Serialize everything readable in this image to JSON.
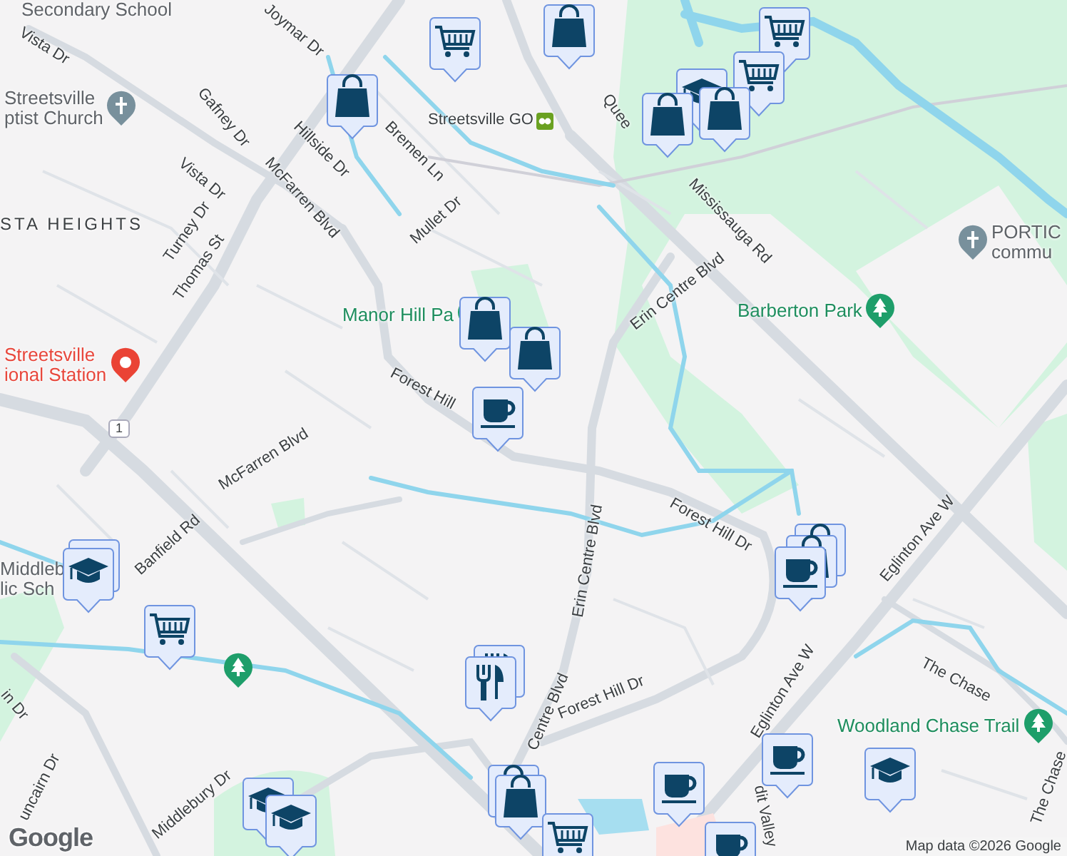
{
  "map": {
    "labels": [
      {
        "kind": "poi",
        "lines": [
          "Secondary School"
        ]
      },
      {
        "kind": "street",
        "lines": [
          "Vista Dr"
        ]
      },
      {
        "kind": "church",
        "lines": [
          "Streetsville",
          "ptist Church"
        ]
      },
      {
        "kind": "street",
        "lines": [
          "Joymar Dr"
        ]
      },
      {
        "kind": "street",
        "lines": [
          "Gafney Dr"
        ]
      },
      {
        "kind": "street",
        "lines": [
          "Hillside Dr"
        ]
      },
      {
        "kind": "street",
        "lines": [
          "Bremen Ln"
        ]
      },
      {
        "kind": "transit",
        "lines": [
          "Streetsville GO"
        ]
      },
      {
        "kind": "street",
        "lines": [
          "Quee"
        ]
      },
      {
        "kind": "street",
        "lines": [
          "Vista Dr"
        ]
      },
      {
        "kind": "street",
        "lines": [
          "Mullet Dr"
        ]
      },
      {
        "kind": "street",
        "lines": [
          "Mississauga Rd"
        ]
      },
      {
        "kind": "area",
        "lines": [
          "STA HEIGHTS"
        ]
      },
      {
        "kind": "street",
        "lines": [
          "Turney Dr"
        ]
      },
      {
        "kind": "street",
        "lines": [
          "Thomas St"
        ]
      },
      {
        "kind": "street",
        "lines": [
          "McFarren Blvd"
        ]
      },
      {
        "kind": "church",
        "lines": [
          "PORTIC",
          "commu"
        ]
      },
      {
        "kind": "street",
        "lines": [
          "Erin Centre Blvd"
        ]
      },
      {
        "kind": "park",
        "lines": [
          "Manor Hill Pa"
        ]
      },
      {
        "kind": "park",
        "lines": [
          "Barberton Park"
        ]
      },
      {
        "kind": "station",
        "lines": [
          "Streetsville",
          "ional Station"
        ]
      },
      {
        "kind": "street",
        "lines": [
          "Forest Hill"
        ]
      },
      {
        "kind": "shield",
        "lines": [
          "1"
        ]
      },
      {
        "kind": "street",
        "lines": [
          "McFarren Blvd"
        ]
      },
      {
        "kind": "street",
        "lines": [
          "Forest Hill Dr"
        ]
      },
      {
        "kind": "street",
        "lines": [
          "Erin Centre Blvd"
        ]
      },
      {
        "kind": "street",
        "lines": [
          "Eglinton Ave W"
        ]
      },
      {
        "kind": "street",
        "lines": [
          "Banfield Rd"
        ]
      },
      {
        "kind": "poi",
        "lines": [
          "Middleb",
          "lic Sch"
        ]
      },
      {
        "kind": "street",
        "lines": [
          "The Chase"
        ]
      },
      {
        "kind": "street",
        "lines": [
          "in Dr"
        ]
      },
      {
        "kind": "street",
        "lines": [
          "Centre Blvd"
        ]
      },
      {
        "kind": "street",
        "lines": [
          "Forest Hill Dr"
        ]
      },
      {
        "kind": "street",
        "lines": [
          "Eglinton Ave W"
        ]
      },
      {
        "kind": "park",
        "lines": [
          "Woodland Chase Trail"
        ]
      },
      {
        "kind": "street",
        "lines": [
          "dit Valley"
        ]
      },
      {
        "kind": "street",
        "lines": [
          "The Chase"
        ]
      },
      {
        "kind": "street",
        "lines": [
          "uncairn Dr"
        ]
      },
      {
        "kind": "street",
        "lines": [
          "Middlebury Dr"
        ]
      }
    ],
    "pins": [
      {
        "kind": "park"
      }
    ],
    "markers": [
      {
        "kind": "grocery"
      },
      {
        "kind": "shopping"
      },
      {
        "kind": "grocery"
      },
      {
        "kind": "grocery"
      },
      {
        "kind": "school"
      },
      {
        "kind": "shopping"
      },
      {
        "kind": "shopping"
      },
      {
        "kind": "shopping"
      },
      {
        "kind": "shopping"
      },
      {
        "kind": "shopping"
      },
      {
        "kind": "cafe"
      },
      {
        "kind": "school"
      },
      {
        "kind": "school"
      },
      {
        "kind": "grocery"
      },
      {
        "kind": "shopping"
      },
      {
        "kind": "shopping"
      },
      {
        "kind": "cafe"
      },
      {
        "kind": "restaurant"
      },
      {
        "kind": "restaurant"
      },
      {
        "kind": "shopping"
      },
      {
        "kind": "shopping"
      },
      {
        "kind": "school"
      },
      {
        "kind": "school"
      },
      {
        "kind": "cafe"
      },
      {
        "kind": "cafe"
      },
      {
        "kind": "school"
      },
      {
        "kind": "grocery"
      },
      {
        "kind": "cafe"
      }
    ],
    "attribution": "Map data ©2026 Google",
    "logo": "Google"
  }
}
